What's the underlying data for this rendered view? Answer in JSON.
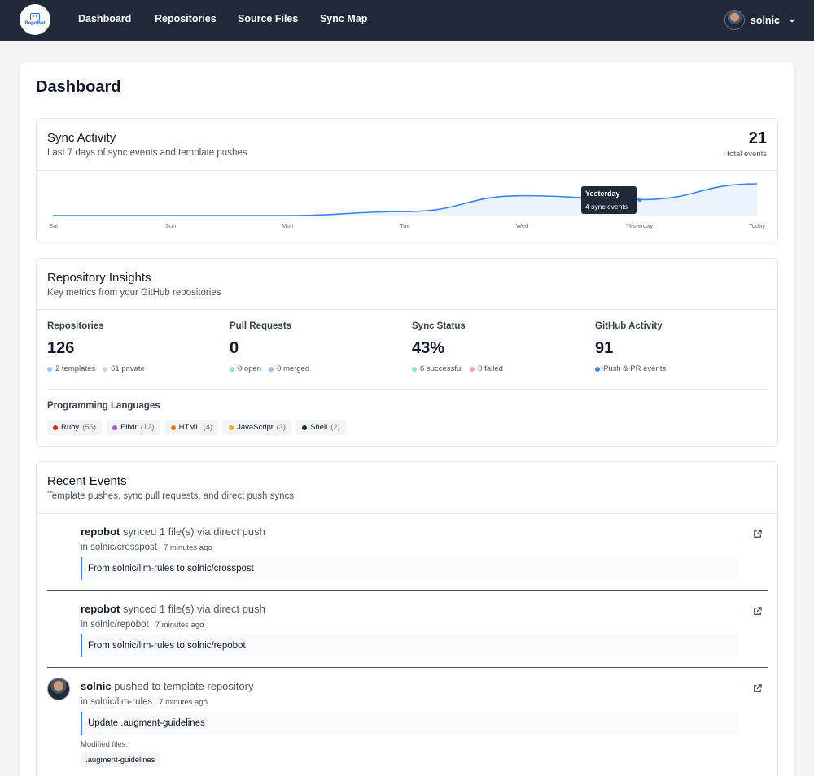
{
  "nav": {
    "logo_text": "RepoBot",
    "links": [
      "Dashboard",
      "Repositories",
      "Source Files",
      "Sync Map"
    ],
    "username": "solnic"
  },
  "page": {
    "title": "Dashboard"
  },
  "sync_activity": {
    "title": "Sync Activity",
    "subtitle": "Last 7 days of sync events and template pushes",
    "total": "21",
    "total_label": "total events",
    "tooltip_title": "Yesterday",
    "tooltip_value": "4 sync events",
    "accent": "#3b82f6",
    "chart_data": {
      "type": "area",
      "categories": [
        "Sat",
        "Sun",
        "Mon",
        "Tue",
        "Wed",
        "Yesterday",
        "Today"
      ],
      "values": [
        0,
        0,
        0,
        1,
        5,
        4,
        8
      ],
      "highlight": {
        "category": "Yesterday",
        "value": 4
      }
    }
  },
  "insights": {
    "title": "Repository Insights",
    "subtitle": "Key metrics from your GitHub repositories",
    "metrics": [
      {
        "label": "Repositories",
        "value": "126",
        "subs": [
          {
            "text": "2 templates",
            "color": "#93c5fd"
          },
          {
            "text": "61 private",
            "color": "#d1d5db"
          }
        ]
      },
      {
        "label": "Pull Requests",
        "value": "0",
        "subs": [
          {
            "text": "0 open",
            "color": "#86efac"
          },
          {
            "text": "0 merged",
            "color": "#93c5fd"
          }
        ]
      },
      {
        "label": "Sync Status",
        "value": "43%",
        "subs": [
          {
            "text": "6 successful",
            "color": "#86efac"
          },
          {
            "text": "0 failed",
            "color": "#fca5a5"
          }
        ]
      },
      {
        "label": "GitHub Activity",
        "value": "91",
        "subs": [
          {
            "text": "Push & PR events",
            "color": "#3b82f6"
          }
        ]
      }
    ],
    "languages_title": "Programming Languages",
    "languages": [
      {
        "name": "Ruby",
        "count": "(55)",
        "color": "#dc2626"
      },
      {
        "name": "Elixir",
        "count": "(12)",
        "color": "#a855f7"
      },
      {
        "name": "HTML",
        "count": "(4)",
        "color": "#f97316"
      },
      {
        "name": "JavaScript",
        "count": "(3)",
        "color": "#eab308"
      },
      {
        "name": "Shell",
        "count": "(2)",
        "color": "#1f2937"
      }
    ]
  },
  "events": {
    "title": "Recent Events",
    "subtitle": "Template pushes, sync pull requests, and direct push syncs",
    "items": [
      {
        "actor": "repobot",
        "action": "synced 1 file(s) via direct push",
        "repo": "in solnic/crosspost",
        "ago": "7 minutes ago",
        "message": "From solnic/llm-rules to solnic/crosspost"
      },
      {
        "actor": "repobot",
        "action": "synced 1 file(s) via direct push",
        "repo": "in solnic/repobot",
        "ago": "7 minutes ago",
        "message": "From solnic/llm-rules to solnic/repobot"
      },
      {
        "actor": "solnic",
        "action": "pushed to template repository",
        "repo": "in solnic/llm-rules",
        "ago": "7 minutes ago",
        "message": "Update .augment-guidelines",
        "modified_label": "Modified files:",
        "files": [
          ".augment-guidelines"
        ]
      }
    ]
  }
}
